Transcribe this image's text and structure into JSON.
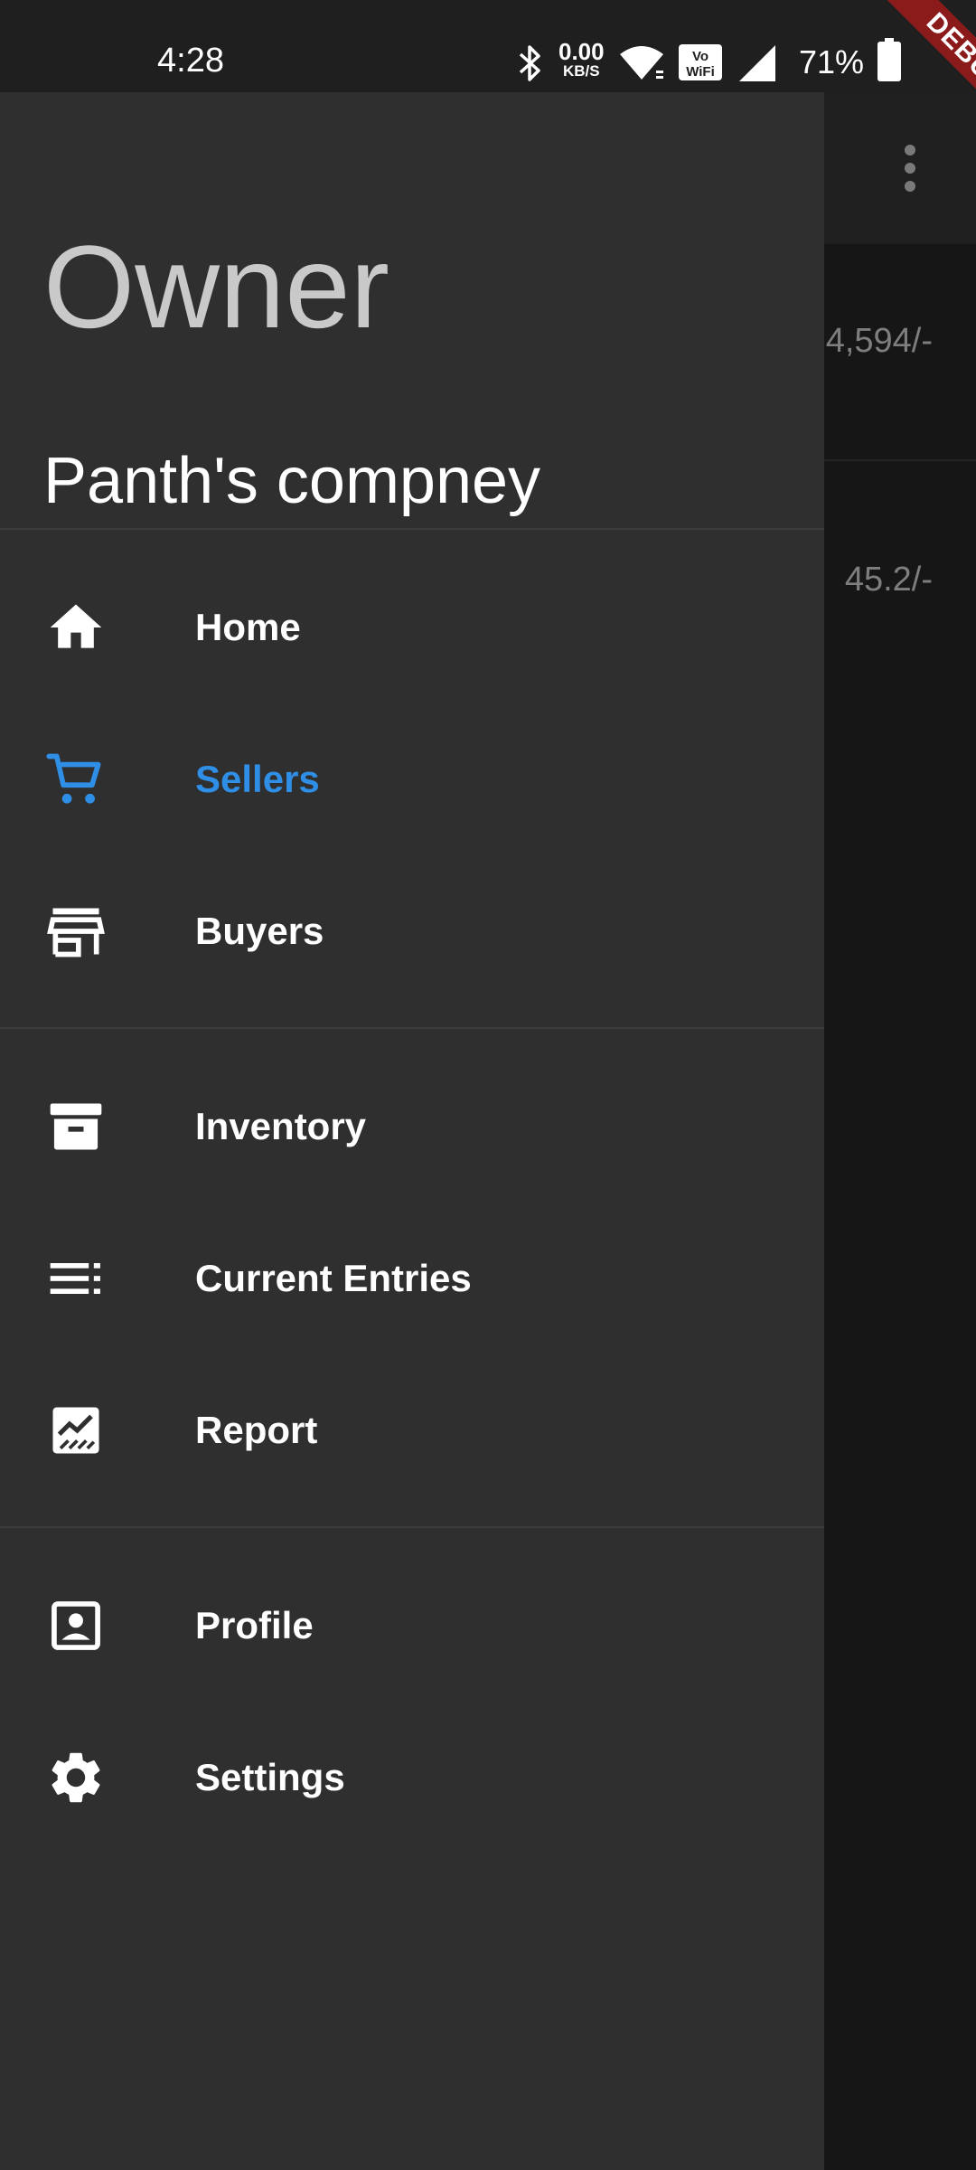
{
  "status_bar": {
    "time": "4:28",
    "net_speed_value": "0.00",
    "net_speed_unit": "KB/S",
    "battery_percent": "71%",
    "icons": [
      "bluetooth-icon",
      "wifi-icon",
      "vowifi-icon",
      "signal-icon",
      "battery-icon"
    ]
  },
  "debug_banner": "DEBUG",
  "background": {
    "amounts": [
      "4,594/-",
      "45.2/-"
    ]
  },
  "drawer": {
    "role": "Owner",
    "company": "Panth's compney",
    "active_color": "#2f8fe6",
    "items": [
      {
        "label": "Home",
        "icon": "home-icon"
      },
      {
        "label": "Sellers",
        "icon": "cart-icon",
        "active": true
      },
      {
        "label": "Buyers",
        "icon": "store-icon"
      },
      {
        "label": "Inventory",
        "icon": "archive-icon"
      },
      {
        "label": "Current Entries",
        "icon": "list-icon"
      },
      {
        "label": "Report",
        "icon": "chart-icon"
      },
      {
        "label": "Profile",
        "icon": "profile-icon"
      },
      {
        "label": "Settings",
        "icon": "gear-icon"
      }
    ]
  }
}
